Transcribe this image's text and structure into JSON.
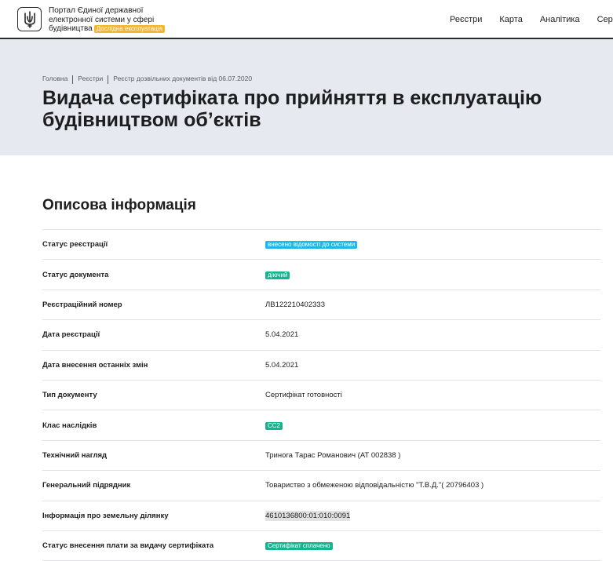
{
  "header": {
    "brand_line1": "Портал Єдиної державної",
    "brand_line2": "електронної системи у сфері",
    "brand_line3": "будівництва",
    "beta_badge": "Дослідна експлуатація",
    "nav": [
      "Реєстри",
      "Карта",
      "Аналітика",
      "Сервіси"
    ]
  },
  "breadcrumb": [
    "Головна",
    "Реєстри",
    "Реєстр дозвільних документів від 06.07.2020"
  ],
  "page_title_line1": "Видача сертифіката про прийняття в експлуатацію",
  "page_title_line2": "будівництвом об’єктів",
  "section_title": "Описова інформація",
  "colors": {
    "accent_info": "#1eb8e6",
    "accent_green": "#16b38f",
    "beta": "#f5b62b",
    "hero_bg": "#e6eaf0"
  },
  "rows": [
    {
      "label": "Статус реєстрації",
      "value": "внесено відомості до системи"
    },
    {
      "label": "Статус документа",
      "value": "діючий"
    },
    {
      "label": "Реєстраційний номер",
      "value": "ЛВ122210402333"
    },
    {
      "label": "Дата реєстрації",
      "value": "5.04.2021"
    },
    {
      "label": "Дата внесення останніх змін",
      "value": "5.04.2021"
    },
    {
      "label": "Тип документу",
      "value": "Сертифікат готовності"
    },
    {
      "label": "Клас наслідків",
      "value": "СС2"
    },
    {
      "label": "Технічний нагляд",
      "value": "Тринога Тарас Романович (АТ 002838 )"
    },
    {
      "label": "Генеральний підрядник",
      "value": "Товариство з обмеженою відповідальністю \"Т.В.Д.\"( 20796403 )"
    },
    {
      "label": "Інформація про земельну ділянку",
      "value": "4610136800:01:010:0091"
    },
    {
      "label": "Статус внесення плати за видачу сертифіката",
      "value": "Сертифікат сплачено"
    }
  ]
}
